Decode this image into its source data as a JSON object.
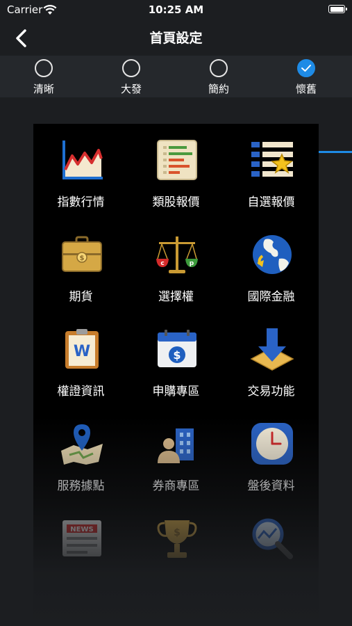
{
  "status_bar": {
    "carrier": "Carrier",
    "time": "10:25 AM"
  },
  "nav": {
    "title": "首頁設定"
  },
  "themes": [
    {
      "label": "清晰",
      "selected": false
    },
    {
      "label": "大發",
      "selected": false
    },
    {
      "label": "簡約",
      "selected": false
    },
    {
      "label": "懷舊",
      "selected": true
    }
  ],
  "colors": {
    "accent": "#1e8be6",
    "background": "#1c1e21",
    "grid_background": "#000000"
  },
  "items": [
    {
      "label": "指數行情",
      "icon": "index-chart-icon"
    },
    {
      "label": "類股報價",
      "icon": "sector-quote-icon"
    },
    {
      "label": "自選報價",
      "icon": "watchlist-quote-icon"
    },
    {
      "label": "期貨",
      "icon": "futures-briefcase-icon"
    },
    {
      "label": "選擇權",
      "icon": "options-scale-icon"
    },
    {
      "label": "國際金融",
      "icon": "globe-icon"
    },
    {
      "label": "權證資訊",
      "icon": "warrant-clipboard-icon"
    },
    {
      "label": "申購專區",
      "icon": "subscription-calendar-icon"
    },
    {
      "label": "交易功能",
      "icon": "trade-arrow-icon"
    },
    {
      "label": "服務據點",
      "icon": "map-pin-icon"
    },
    {
      "label": "券商專區",
      "icon": "broker-building-icon"
    },
    {
      "label": "盤後資料",
      "icon": "clock-icon"
    },
    {
      "label": "",
      "icon": "news-icon"
    },
    {
      "label": "",
      "icon": "trophy-icon"
    },
    {
      "label": "",
      "icon": "magnifier-chart-icon"
    }
  ]
}
